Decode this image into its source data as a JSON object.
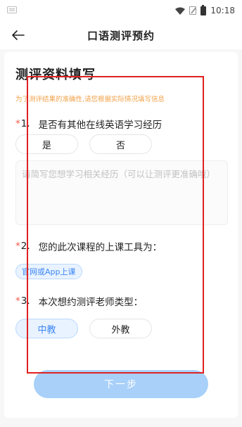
{
  "status_bar": {
    "left_icon": "notification-icon",
    "time": "10:18",
    "icons": [
      "wifi-icon",
      "no-sim-icon",
      "battery-icon"
    ]
  },
  "header": {
    "back_icon": "arrow-left-icon",
    "title": "口语测评预约"
  },
  "form": {
    "title": "测评资料填写",
    "hint": "为了测评结果的准确性,请您根据实际情况填写信息",
    "q1": {
      "required_mark": "*",
      "number": "1.",
      "label": "是否有其他在线英语学习经历",
      "options": [
        "是",
        "否"
      ],
      "textarea_placeholder": "请简写您想学习相关经历（可以让测评更准确哦）"
    },
    "q2": {
      "required_mark": "*",
      "number": "2.",
      "label": "您的此次课程的上课工具为：",
      "selected_tag": "官网或App上课"
    },
    "q3": {
      "required_mark": "*",
      "number": "3.",
      "label": "本次想约测评老师类型：",
      "options": [
        "中教",
        "外教"
      ],
      "selected": "中教"
    },
    "next_button": "下一步"
  },
  "colors": {
    "accent": "#3c86f5",
    "accent_bg": "#e9f3ff",
    "hint": "#f0a24a",
    "required": "#f05a4a",
    "button_disabled": "#a8d0f9",
    "highlight": "#e02020"
  }
}
